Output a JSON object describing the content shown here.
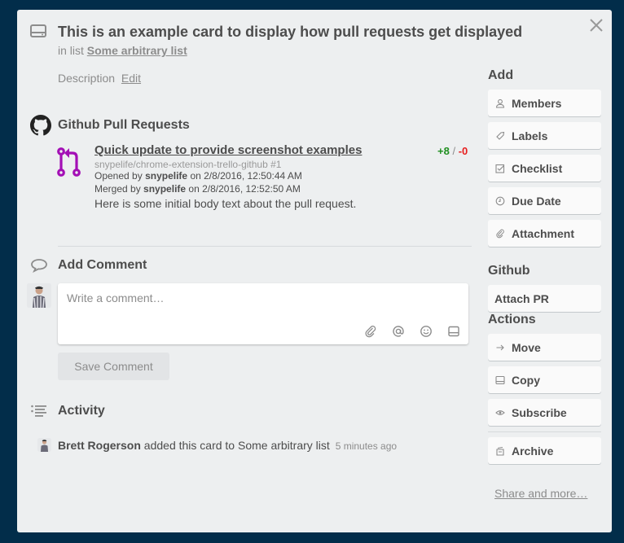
{
  "card": {
    "title": "This is an example card to display how pull requests get displayed",
    "in_list_prefix": "in list",
    "list_name": "Some arbitrary list",
    "description_label": "Description",
    "edit_label": "Edit"
  },
  "github_section": {
    "title": "Github Pull Requests",
    "pull_request": {
      "title": "Quick update to provide screenshot examples",
      "additions": "+8",
      "separator": "/",
      "deletions": "-0",
      "repo": "snypelife/chrome-extension-trello-github #1",
      "opened_prefix": "Opened by",
      "opened_user": "snypelife",
      "opened_on": "on 2/8/2016, 12:50:44 AM",
      "merged_prefix": "Merged by",
      "merged_user": "snypelife",
      "merged_on": "on 2/8/2016, 12:52:50 AM",
      "body": "Here is some initial body text about the pull request.",
      "icon_color": "#a30fb5"
    }
  },
  "comment": {
    "title": "Add Comment",
    "placeholder": "Write a comment…",
    "value": "",
    "save_label": "Save Comment",
    "tool_icons": [
      "attachment-icon",
      "mention-icon",
      "emoji-icon",
      "card-icon"
    ]
  },
  "activity": {
    "title": "Activity",
    "items": [
      {
        "user": "Brett Rogerson",
        "action": "added this card to Some arbitrary list",
        "time": "5 minutes ago"
      }
    ]
  },
  "sidebar": {
    "add_heading": "Add",
    "add_buttons": [
      {
        "label": "Members",
        "icon": "member-icon"
      },
      {
        "label": "Labels",
        "icon": "label-icon"
      },
      {
        "label": "Checklist",
        "icon": "checklist-icon"
      },
      {
        "label": "Due Date",
        "icon": "clock-icon"
      },
      {
        "label": "Attachment",
        "icon": "attachment-icon"
      }
    ],
    "github_heading": "Github",
    "attach_pr_label": "Attach PR",
    "actions_heading": "Actions",
    "action_buttons": [
      {
        "label": "Move",
        "icon": "arrow-right-icon"
      },
      {
        "label": "Copy",
        "icon": "card-icon"
      },
      {
        "label": "Subscribe",
        "icon": "eye-icon"
      },
      {
        "label": "Archive",
        "icon": "archive-icon"
      }
    ],
    "share_label": "Share and more…"
  },
  "colors": {
    "background": "#022d4a",
    "panel": "#edeff0",
    "additions": "#1f8f1f",
    "deletions": "#e61e1e"
  }
}
